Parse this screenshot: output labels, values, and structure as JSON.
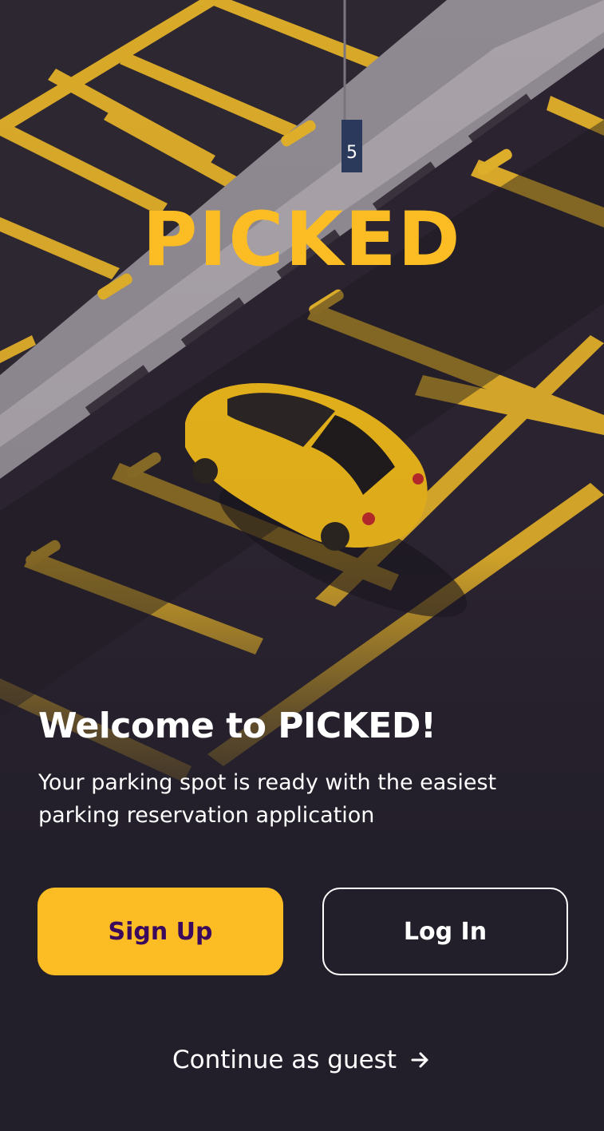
{
  "app": {
    "logo_text": "PICKED"
  },
  "hero": {
    "image": "aerial view of parking garage with yellow car",
    "pillar_sign": "5"
  },
  "welcome": {
    "title": "Welcome to PICKED!",
    "subtitle": "Your parking spot is ready with the easiest parking reservation application"
  },
  "actions": {
    "signup_label": "Sign Up",
    "login_label": "Log In",
    "guest_label": "Continue as guest",
    "guest_icon": "arrow-right-icon"
  },
  "colors": {
    "accent": "#fbbd23",
    "background": "#231f2a",
    "signup_text": "#3b0a5c",
    "text": "#ffffff"
  }
}
